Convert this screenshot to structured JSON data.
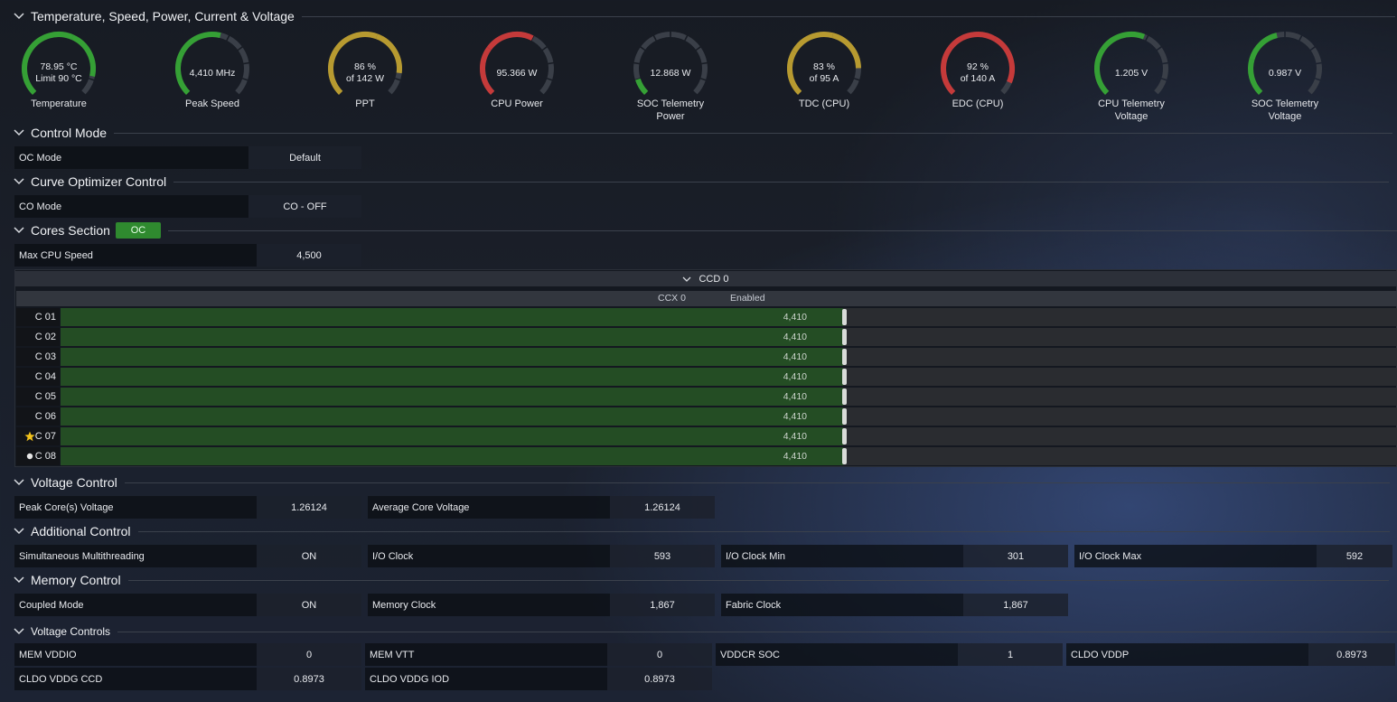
{
  "sections": {
    "sensors": "Temperature, Speed, Power, Current & Voltage",
    "control_mode": "Control Mode",
    "curve_optimizer": "Curve Optimizer Control",
    "cores": "Cores Section",
    "cores_badge": "OC",
    "voltage_control": "Voltage Control",
    "additional_control": "Additional Control",
    "memory_control": "Memory Control",
    "voltage_controls": "Voltage Controls"
  },
  "gauges": [
    {
      "line1": "78.95 °C",
      "line2": "Limit 90 °C",
      "label1": "Temperature",
      "label2": "",
      "fraction": 0.88,
      "color": "#35a035"
    },
    {
      "line1": "4,410  MHz",
      "line2": "",
      "label1": "Peak Speed",
      "label2": "",
      "fraction": 0.55,
      "color": "#35a035"
    },
    {
      "line1": "86 %",
      "line2": "of 142 W",
      "label1": "PPT",
      "label2": "",
      "fraction": 0.86,
      "color": "#b79a30"
    },
    {
      "line1": "95.366 W",
      "line2": "",
      "label1": "CPU Power",
      "label2": "",
      "fraction": 0.6,
      "color": "#c53a3a"
    },
    {
      "line1": "12.868 W",
      "line2": "",
      "label1": "SOC Telemetry",
      "label2": "Power",
      "fraction": 0.1,
      "color": "#35a035"
    },
    {
      "line1": "83 %",
      "line2": "of 95 A",
      "label1": "TDC (CPU)",
      "label2": "",
      "fraction": 0.83,
      "color": "#b79a30"
    },
    {
      "line1": "92 %",
      "line2": "of 140 A",
      "label1": "EDC (CPU)",
      "label2": "",
      "fraction": 0.92,
      "color": "#c53a3a"
    },
    {
      "line1": "1.205 V",
      "line2": "",
      "label1": "CPU Telemetry",
      "label2": "Voltage",
      "fraction": 0.58,
      "color": "#35a035"
    },
    {
      "line1": "0.987 V",
      "line2": "",
      "label1": "SOC Telemetry",
      "label2": "Voltage",
      "fraction": 0.45,
      "color": "#35a035"
    }
  ],
  "control_mode": {
    "key": "OC Mode",
    "value": "Default"
  },
  "curve_optimizer": {
    "key": "CO Mode",
    "value": "CO - OFF"
  },
  "cores_section": {
    "key": "Max CPU Speed",
    "value": "4,500"
  },
  "ccd": {
    "title": "CCD 0",
    "ccx": "CCX 0",
    "status": "Enabled"
  },
  "cores": [
    {
      "name": "C 01",
      "value": "4,410",
      "fraction": 0.98,
      "mark": ""
    },
    {
      "name": "C 02",
      "value": "4,410",
      "fraction": 0.98,
      "mark": ""
    },
    {
      "name": "C 03",
      "value": "4,410",
      "fraction": 0.98,
      "mark": ""
    },
    {
      "name": "C 04",
      "value": "4,410",
      "fraction": 0.98,
      "mark": ""
    },
    {
      "name": "C 05",
      "value": "4,410",
      "fraction": 0.98,
      "mark": ""
    },
    {
      "name": "C 06",
      "value": "4,410",
      "fraction": 0.98,
      "mark": ""
    },
    {
      "name": "C 07",
      "value": "4,410",
      "fraction": 0.98,
      "mark": "star-icon"
    },
    {
      "name": "C 08",
      "value": "4,410",
      "fraction": 0.98,
      "mark": "dot-icon"
    }
  ],
  "voltage_control": [
    {
      "key": "Peak Core(s) Voltage",
      "value": "1.26124"
    },
    {
      "key": "Average Core Voltage",
      "value": "1.26124"
    }
  ],
  "additional_control": [
    {
      "key": "Simultaneous Multithreading",
      "value": "ON"
    },
    {
      "key": "I/O Clock",
      "value": "593"
    },
    {
      "key": "I/O Clock Min",
      "value": "301"
    },
    {
      "key": "I/O Clock Max",
      "value": "592"
    }
  ],
  "memory_control": [
    {
      "key": "Coupled Mode",
      "value": "ON"
    },
    {
      "key": "Memory Clock",
      "value": "1,867"
    },
    {
      "key": "Fabric Clock",
      "value": "1,867"
    }
  ],
  "voltage_controls": [
    {
      "key": "MEM VDDIO",
      "value": "0"
    },
    {
      "key": "MEM VTT",
      "value": "0"
    },
    {
      "key": "VDDCR SOC",
      "value": "1"
    },
    {
      "key": "CLDO VDDP",
      "value": "0.8973"
    },
    {
      "key": "CLDO VDDG CCD",
      "value": "0.8973"
    },
    {
      "key": "CLDO VDDG IOD",
      "value": "0.8973"
    }
  ],
  "colors": {
    "accent_green": "#2f8a2f",
    "bar_green": "#244d24",
    "gauge_track": "#3a3f48"
  }
}
